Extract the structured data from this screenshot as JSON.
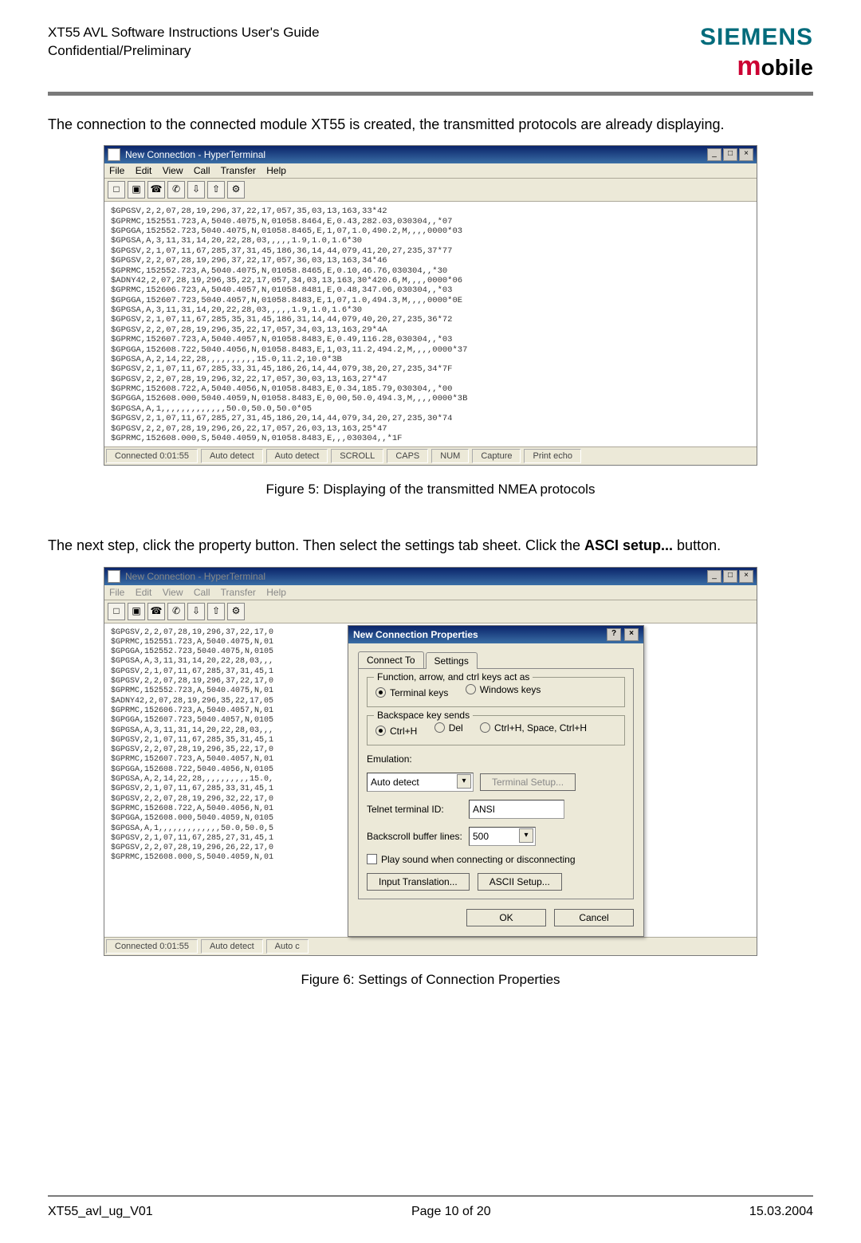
{
  "header": {
    "title_line1": "XT55 AVL Software Instructions User's Guide",
    "title_line2": "Confidential/Preliminary",
    "brand_top": "SIEMENS",
    "brand_m": "m",
    "brand_rest": "obile"
  },
  "para1": "The connection to the connected module XT55 is created, the transmitted protocols are already displaying.",
  "fig5": "Figure 5: Displaying of the transmitted NMEA protocols",
  "para2_a": "The next step, click the property button. Then select the settings tab sheet. Click the ",
  "para2_b": "ASCI setup...",
  "para2_c": " button.",
  "fig6": "Figure 6: Settings of Connection Properties",
  "hyperterm": {
    "title": "New Connection - HyperTerminal",
    "menu": {
      "file": "File",
      "edit": "Edit",
      "view": "View",
      "call": "Call",
      "transfer": "Transfer",
      "help": "Help"
    },
    "nmea": "$GPGSV,2,2,07,28,19,296,37,22,17,057,35,03,13,163,33*42\n$GPRMC,152551.723,A,5040.4075,N,01058.8464,E,0.43,282.03,030304,,*07\n$GPGGA,152552.723,5040.4075,N,01058.8465,E,1,07,1.0,490.2,M,,,,0000*03\n$GPGSA,A,3,11,31,14,20,22,28,03,,,,,1.9,1.0,1.6*30\n$GPGSV,2,1,07,11,67,285,37,31,45,186,36,14,44,079,41,20,27,235,37*77\n$GPGSV,2,2,07,28,19,296,37,22,17,057,36,03,13,163,34*46\n$GPRMC,152552.723,A,5040.4075,N,01058.8465,E,0.10,46.76,030304,,*30\n$ADNY42,2,07,28,19,296,35,22,17,057,34,03,13,163,30*420.6,M,,,,0000*06\n$GPRMC,152606.723,A,5040.4057,N,01058.8481,E,0.48,347.06,030304,,*03\n$GPGGA,152607.723,5040.4057,N,01058.8483,E,1,07,1.0,494.3,M,,,,0000*0E\n$GPGSA,A,3,11,31,14,20,22,28,03,,,,,1.9,1.0,1.6*30\n$GPGSV,2,1,07,11,67,285,35,31,45,186,31,14,44,079,40,20,27,235,36*72\n$GPGSV,2,2,07,28,19,296,35,22,17,057,34,03,13,163,29*4A\n$GPRMC,152607.723,A,5040.4057,N,01058.8483,E,0.49,116.28,030304,,*03\n$GPGGA,152608.722,5040.4056,N,01058.8483,E,1,03,11.2,494.2,M,,,,0000*37\n$GPGSA,A,2,14,22,28,,,,,,,,,,15.0,11.2,10.0*3B\n$GPGSV,2,1,07,11,67,285,33,31,45,186,26,14,44,079,38,20,27,235,34*7F\n$GPGSV,2,2,07,28,19,296,32,22,17,057,30,03,13,163,27*47\n$GPRMC,152608.722,A,5040.4056,N,01058.8483,E,0.34,185.79,030304,,*00\n$GPGGA,152608.000,5040.4059,N,01058.8483,E,0,00,50.0,494.3,M,,,,0000*3B\n$GPGSA,A,1,,,,,,,,,,,,,50.0,50.0,50.0*05\n$GPGSV,2,1,07,11,67,285,27,31,45,186,20,14,44,079,34,20,27,235,30*74\n$GPGSV,2,2,07,28,19,296,26,22,17,057,26,03,13,163,25*47\n$GPRMC,152608.000,S,5040.4059,N,01058.8483,E,,,030304,,*1F",
    "status": {
      "conn": "Connected 0:01:55",
      "auto1": "Auto detect",
      "auto2": "Auto detect",
      "scroll": "SCROLL",
      "caps": "CAPS",
      "num": "NUM",
      "capture": "Capture",
      "echo": "Print echo"
    }
  },
  "ss2": {
    "left": "$GPGSV,2,2,07,28,19,296,37,22,17,0\n$GPRMC,152551.723,A,5040.4075,N,01\n$GPGGA,152552.723,5040.4075,N,0105\n$GPGSA,A,3,11,31,14,20,22,28,03,,,\n$GPGSV,2,1,07,11,67,285,37,31,45,1\n$GPGSV,2,2,07,28,19,296,37,22,17,0\n$GPRMC,152552.723,A,5040.4075,N,01\n$ADNY42,2,07,28,19,296,35,22,17,05\n$GPRMC,152606.723,A,5040.4057,N,01\n$GPGGA,152607.723,5040.4057,N,0105\n$GPGSA,A,3,11,31,14,20,22,28,03,,,\n$GPGSV,2,1,07,11,67,285,35,31,45,1\n$GPGSV,2,2,07,28,19,296,35,22,17,0\n$GPRMC,152607.723,A,5040.4057,N,01\n$GPGGA,152608.722,5040.4056,N,0105\n$GPGSA,A,2,14,22,28,,,,,,,,,,15.0,\n$GPGSV,2,1,07,11,67,285,33,31,45,1\n$GPGSV,2,2,07,28,19,296,32,22,17,0\n$GPRMC,152608.722,A,5040.4056,N,01\n$GPGGA,152608.000,5040.4059,N,0105\n$GPGSA,A,1,,,,,,,,,,,,,50.0,50.0,5\n$GPGSV,2,1,07,11,67,285,27,31,45,1\n$GPGSV,2,2,07,28,19,296,26,22,17,0\n$GPRMC,152608.000,S,5040.4059,N,01",
    "status": {
      "conn": "Connected 0:01:55",
      "auto": "Auto detect",
      "autoc": "Auto c"
    },
    "dialog": {
      "title": "New Connection Properties",
      "tab1": "Connect To",
      "tab2": "Settings",
      "grp1": "Function, arrow, and ctrl keys act as",
      "opt_term": "Terminal keys",
      "opt_win": "Windows keys",
      "grp2": "Backspace key sends",
      "opt_ch": "Ctrl+H",
      "opt_del": "Del",
      "opt_chs": "Ctrl+H, Space, Ctrl+H",
      "emul": "Emulation:",
      "emul_val": "Auto detect",
      "termsetup": "Terminal Setup...",
      "telnet": "Telnet terminal ID:",
      "telnet_val": "ANSI",
      "backscroll": "Backscroll buffer lines:",
      "backscroll_val": "500",
      "playsnd": "Play sound when connecting or disconnecting",
      "inputtrans": "Input Translation...",
      "ascii": "ASCII Setup...",
      "ok": "OK",
      "cancel": "Cancel"
    }
  },
  "footer": {
    "left": "XT55_avl_ug_V01",
    "center": "Page 10 of 20",
    "right": "15.03.2004"
  }
}
